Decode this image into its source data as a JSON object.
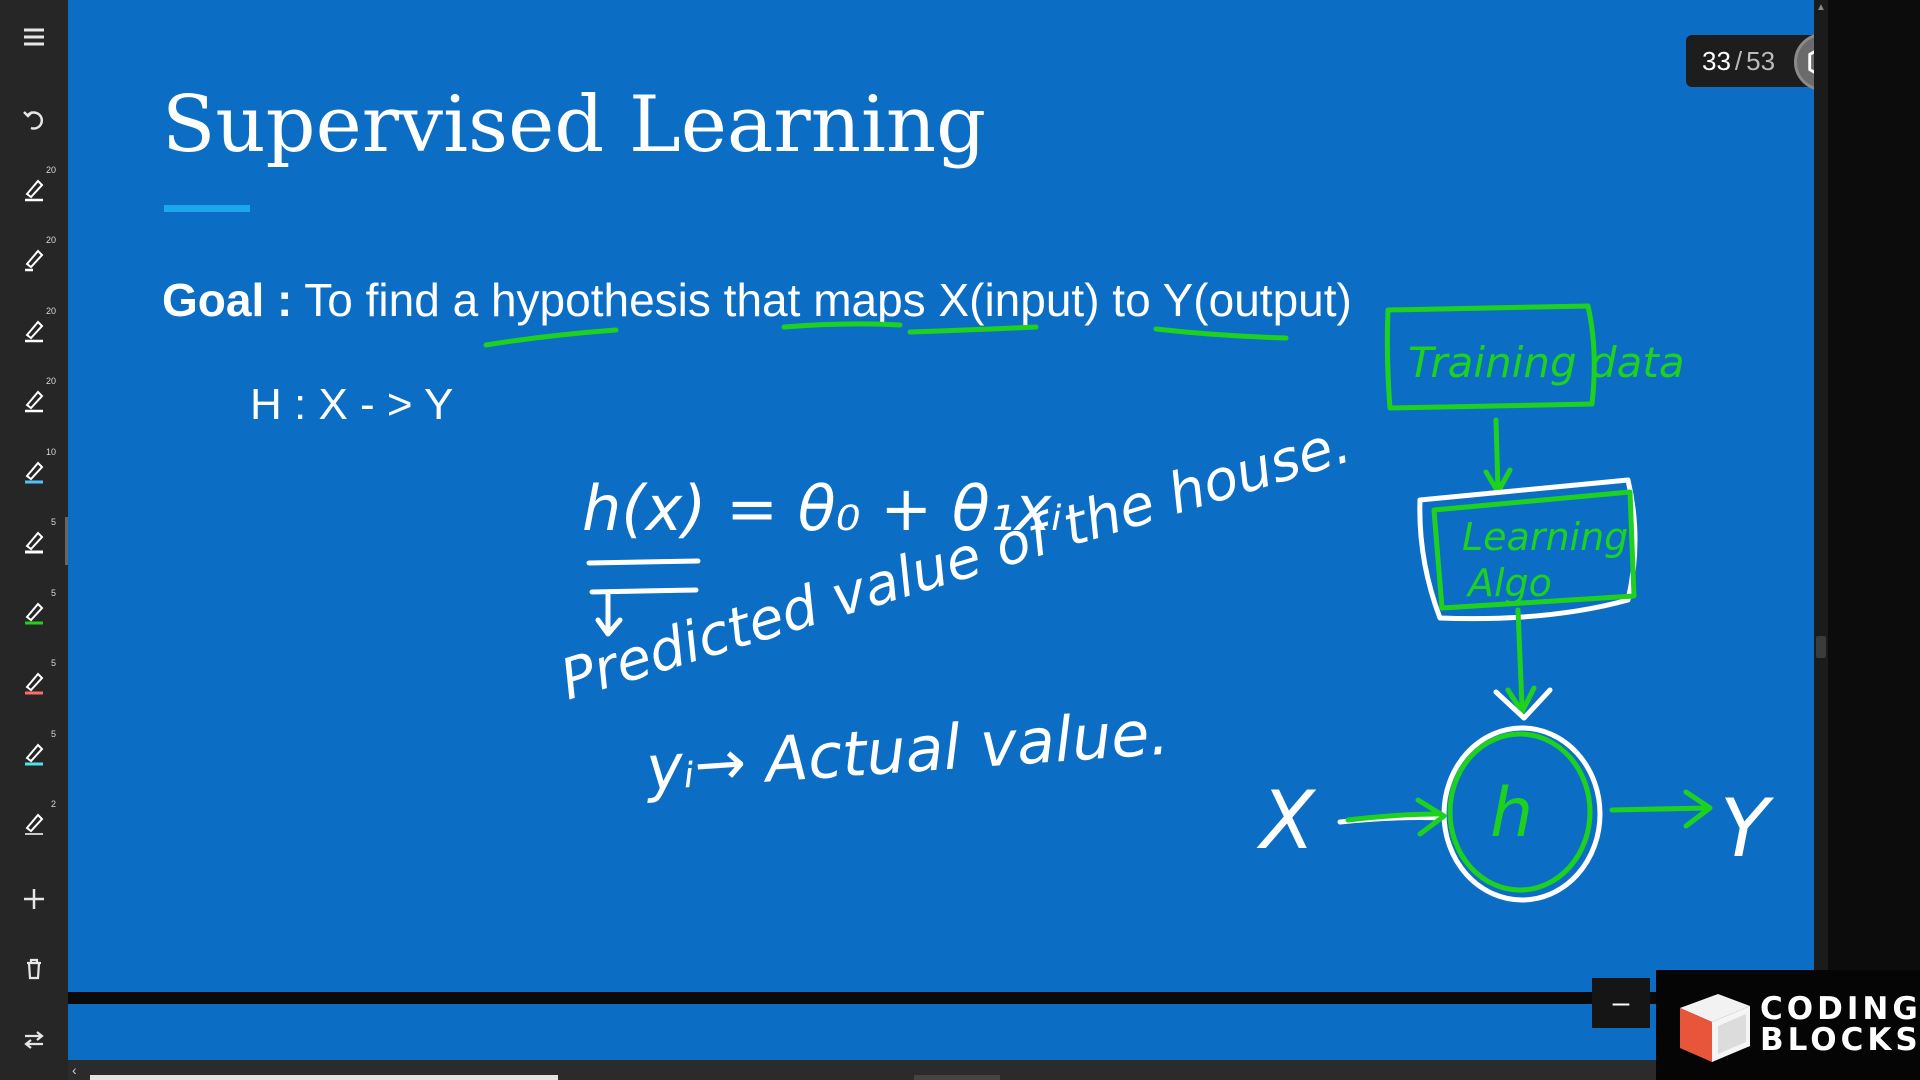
{
  "toolbar": {
    "items": [
      {
        "name": "menu",
        "icon": "hamburger-icon"
      },
      {
        "name": "undo",
        "icon": "undo-icon"
      },
      {
        "name": "pen-1",
        "icon": "pen-icon",
        "color": "#ffffff",
        "size": "20"
      },
      {
        "name": "pen-2",
        "icon": "pen-icon",
        "color": "#ffffff",
        "size": "20"
      },
      {
        "name": "pen-3",
        "icon": "pen-icon",
        "color": "#ffffff",
        "size": "20"
      },
      {
        "name": "pen-4",
        "icon": "pen-icon",
        "color": "#ffffff",
        "size": "20"
      },
      {
        "name": "pen-5",
        "icon": "pen-icon",
        "color": "#4fc3f7",
        "size": "10"
      },
      {
        "name": "pen-6",
        "icon": "pen-icon",
        "color": "#ffffff",
        "size": "5",
        "active": true
      },
      {
        "name": "pen-7",
        "icon": "pen-icon",
        "color": "#1fd11f",
        "size": "5"
      },
      {
        "name": "pen-8",
        "icon": "pen-icon",
        "color": "#ff6b6b",
        "size": "5"
      },
      {
        "name": "pen-9",
        "icon": "pen-icon",
        "color": "#4fe3e3",
        "size": "5"
      },
      {
        "name": "pen-10",
        "icon": "pen-icon",
        "color": "#ffffff",
        "size": "2"
      },
      {
        "name": "add",
        "icon": "plus-icon"
      },
      {
        "name": "delete",
        "icon": "trash-icon"
      },
      {
        "name": "swap",
        "icon": "swap-arrows-icon"
      }
    ]
  },
  "slide": {
    "title": "Supervised Learning",
    "goal_label": "Goal :",
    "goal_text_1": " To find a ",
    "goal_hypothesis": "hypothesis",
    "goal_text_2": " that ",
    "goal_maps": "maps",
    "goal_text_3": " ",
    "goal_x": "X(input)",
    "goal_text_4": " to ",
    "goal_y": "Y(output)",
    "formula": "H : X - > Y"
  },
  "annotations": {
    "hx": "h(x) = θ₀ + θ₁xᵢ",
    "predicted": "Predicted value of the house.",
    "actual": "yᵢ→ Actual value.",
    "training_data": "Training data",
    "learning_algo_1": "Learning",
    "learning_algo_2": "Algo",
    "h": "h",
    "x": "X",
    "y": "Y",
    "colors": {
      "white": "#ffffff",
      "green": "#1fd11f"
    }
  },
  "pager": {
    "current": "33",
    "separator": "/",
    "total": "53",
    "settings_icon": "settings-hexagon-icon"
  },
  "controls": {
    "minimize": "–"
  },
  "brand": {
    "line1": "CODING",
    "line2": "BLOCKS",
    "logo_icon": "cube-logo"
  },
  "colors": {
    "slide_bg": "#0b6ec4",
    "accent": "#1ba8ea",
    "toolbar_bg": "#262626"
  }
}
